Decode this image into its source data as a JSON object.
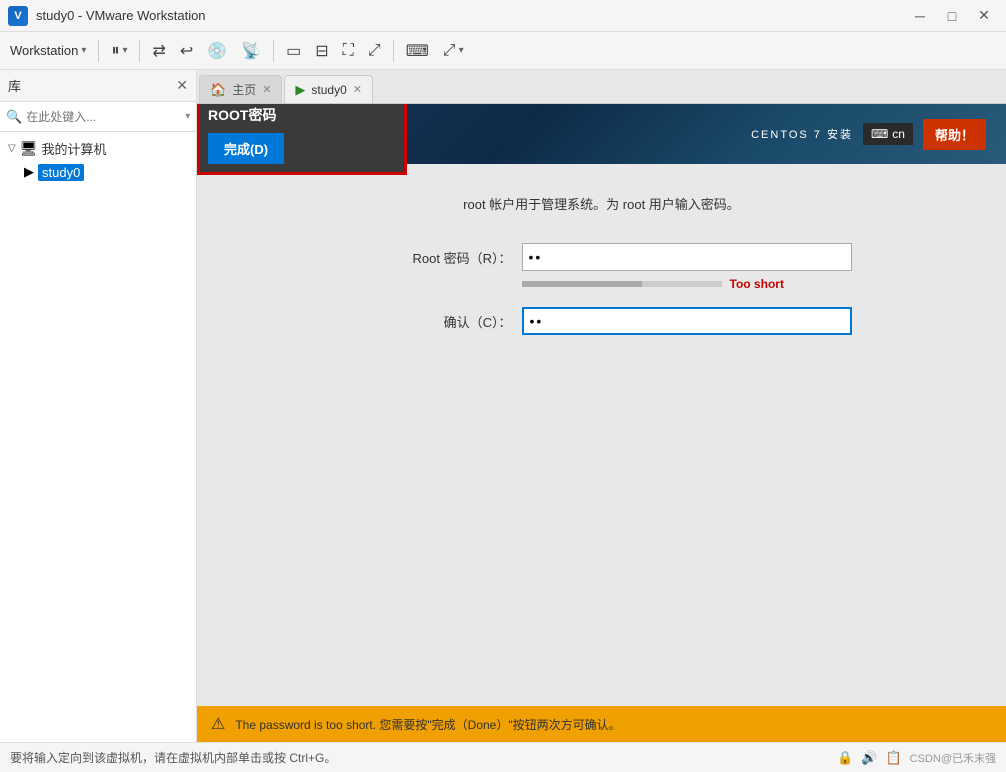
{
  "titlebar": {
    "title": "study0 - VMware Workstation",
    "min_btn": "─",
    "max_btn": "□",
    "close_btn": "✕"
  },
  "menubar": {
    "workstation_label": "Workstation",
    "dropdown_arrow": "▾",
    "pause_label": "⏸",
    "toolbar_icons": [
      "⏸",
      "↩",
      "💿",
      "📡",
      "◻",
      "⬜",
      "⬛",
      "⬛",
      "⌨",
      "⤢"
    ]
  },
  "sidebar": {
    "title": "库",
    "close_label": "✕",
    "search_placeholder": "在此处键入...",
    "tree": {
      "my_computer_label": "我的计算机",
      "vm_label": "study0"
    }
  },
  "tabs": {
    "home_label": "主页",
    "vm_label": "study0",
    "home_icon": "🏠",
    "vm_icon": "▶"
  },
  "installer": {
    "title": "ROOT密码",
    "centos_title": "CENTOS 7 安装",
    "lang_code": "cn",
    "help_label": "帮助！",
    "description": "root 帐户用于管理系统。为 root 用户输入密码。",
    "pwd_label": "Root 密码（R）：",
    "confirm_label": "确认（C）：",
    "strength_text": "Too short",
    "done_label": "完成(D)",
    "pwd_value": "••",
    "confirm_value": "••"
  },
  "warning": {
    "icon": "⚠",
    "text": "The password is too short. 您需要按\"完成（Done）\"按钮两次方可确认。"
  },
  "statusbar": {
    "hint_text": "要将输入定向到该虚拟机，请在虚拟机内部单击或按 Ctrl+G。",
    "right_icons": [
      "🔒",
      "🔊",
      "📋",
      "CSDN@已禾末强"
    ]
  }
}
